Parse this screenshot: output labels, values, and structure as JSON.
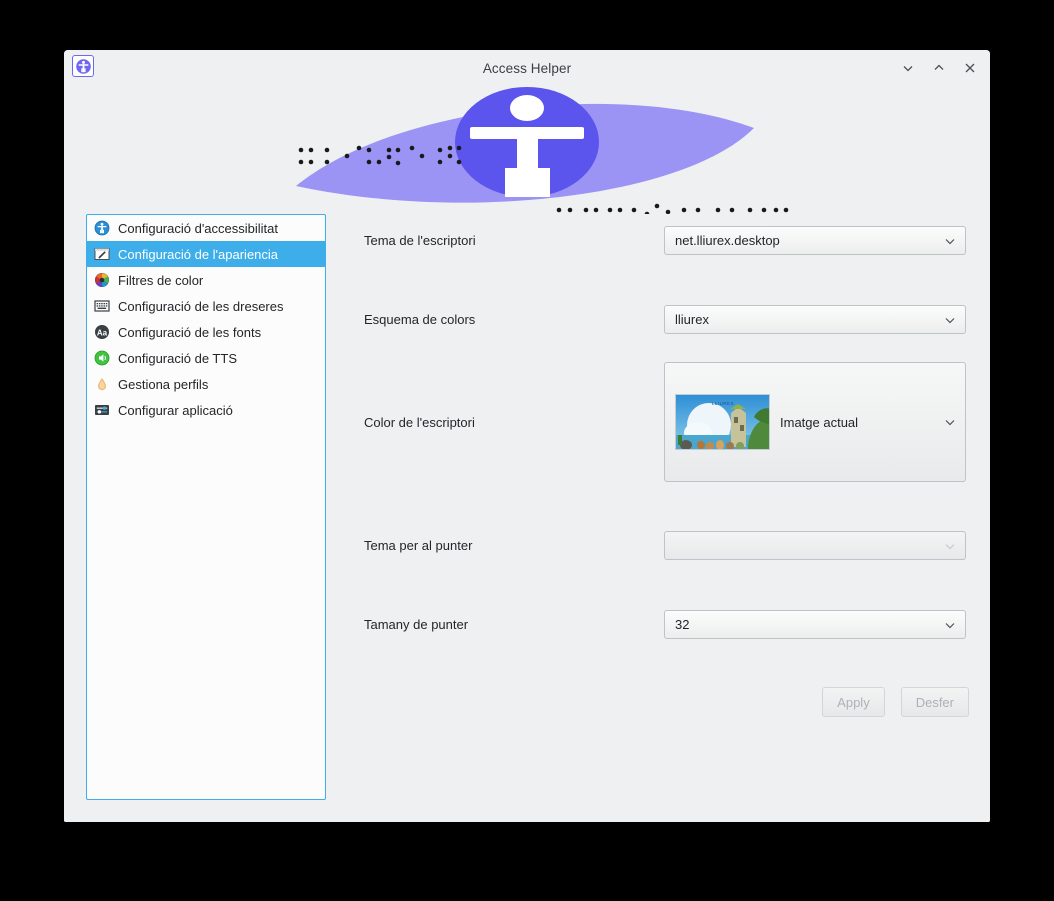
{
  "window": {
    "title": "Access Helper",
    "app_icon": "accessibility-icon",
    "controls": [
      {
        "name": "minimize",
        "icon": "chevron-down-icon"
      },
      {
        "name": "maximize",
        "icon": "chevron-up-icon"
      },
      {
        "name": "close",
        "icon": "close-icon"
      }
    ]
  },
  "banner": {
    "logo_icon": "accessibility-person-icon",
    "braille_left": "braille-dots",
    "braille_right": "braille-dots",
    "colors": {
      "lens": "#9b94f5",
      "circle": "#5b55ee",
      "figure": "#ffffff"
    }
  },
  "sidebar": {
    "items": [
      {
        "label": "Configuració d'accessibilitat",
        "icon": "accessibility-icon",
        "selected": false
      },
      {
        "label": "Configuració de l'apariencia",
        "icon": "appearance-pencil-icon",
        "selected": true
      },
      {
        "label": "Filtres de color",
        "icon": "color-wheel-icon",
        "selected": false
      },
      {
        "label": "Configuració de les dreseres",
        "icon": "keyboard-icon",
        "selected": false
      },
      {
        "label": "Configuració de les fonts",
        "icon": "font-aa-icon",
        "selected": false
      },
      {
        "label": "Configuració de TTS",
        "icon": "tts-speaker-icon",
        "selected": false
      },
      {
        "label": "Gestiona perfils",
        "icon": "droplet-icon",
        "selected": false
      },
      {
        "label": "Configurar aplicació",
        "icon": "sliders-icon",
        "selected": false
      }
    ]
  },
  "form": {
    "fields": [
      {
        "label": "Tema de l'escriptori",
        "value": "net.lliurex.desktop",
        "type": "combobox",
        "disabled": false
      },
      {
        "label": "Esquema de colors",
        "value": "lliurex",
        "type": "combobox",
        "disabled": false
      },
      {
        "label": "Color de l'escriptori",
        "value": "Imatge actual",
        "type": "image-combobox",
        "disabled": false,
        "thumbnail": "lliurex-wallpaper"
      },
      {
        "label": "Tema per al punter",
        "value": "",
        "type": "combobox",
        "disabled": true
      },
      {
        "label": "Tamany de punter",
        "value": "32",
        "type": "combobox",
        "disabled": false
      }
    ]
  },
  "buttons": {
    "apply": "Apply",
    "undo": "Desfer"
  },
  "colors": {
    "accent": "#3daee9",
    "window_bg": "#eff0f1",
    "list_bg": "#fcfcfc",
    "text": "#232629",
    "disabled_text": "#adb2b6"
  }
}
